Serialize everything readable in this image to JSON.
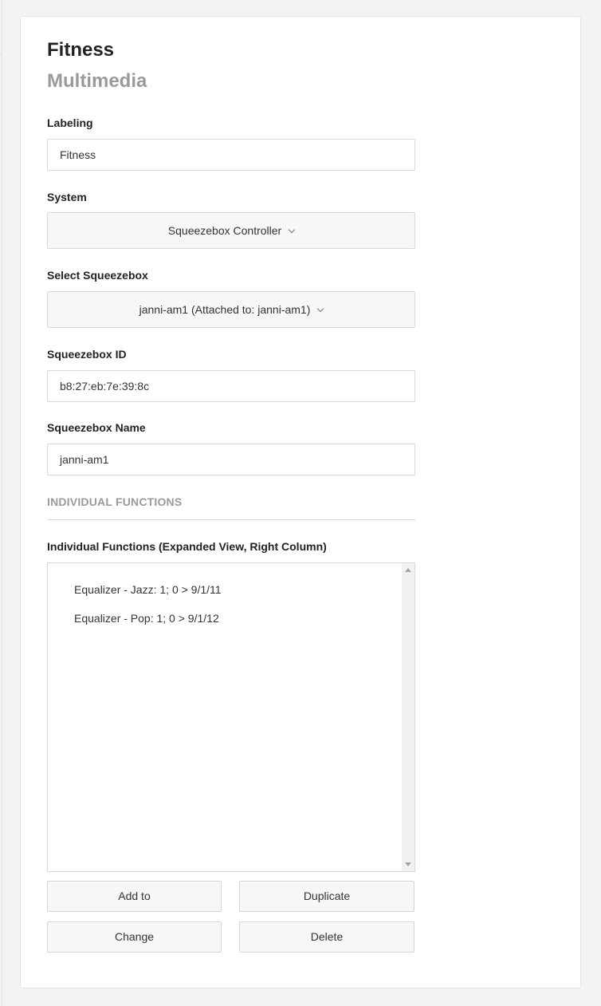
{
  "header": {
    "title": "Fitness",
    "subtitle": "Multimedia"
  },
  "fields": {
    "labeling": {
      "label": "Labeling",
      "value": "Fitness"
    },
    "system": {
      "label": "System",
      "value": "Squeezebox Controller"
    },
    "select_squeezebox": {
      "label": "Select Squeezebox",
      "value": "janni-am1 (Attached to: janni-am1)"
    },
    "squeezebox_id": {
      "label": "Squeezebox ID",
      "value": "b8:27:eb:7e:39:8c"
    },
    "squeezebox_name": {
      "label": "Squeezebox Name",
      "value": "janni-am1"
    }
  },
  "individual_functions": {
    "section_heading": "INDIVIDUAL FUNCTIONS",
    "list_label": "Individual Functions (Expanded View, Right Column)",
    "items": [
      "Equalizer - Jazz: 1; 0 > 9/1/11",
      "Equalizer - Pop: 1; 0 > 9/1/12"
    ]
  },
  "buttons": {
    "add_to": "Add to",
    "duplicate": "Duplicate",
    "change": "Change",
    "delete": "Delete"
  }
}
